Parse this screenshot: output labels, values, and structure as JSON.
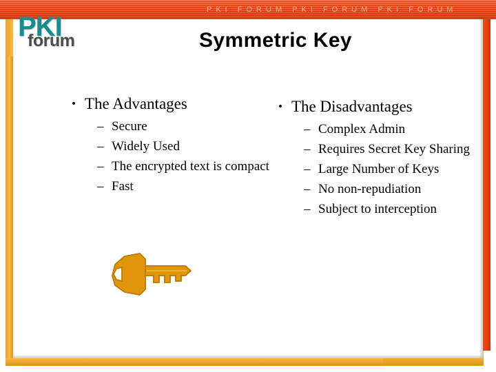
{
  "banner": {
    "repeat_text": "PKI   FORUM   PKI   FORUM   PKI   FORUM",
    "color": "#ef4a17"
  },
  "logo": {
    "line1": "PKI",
    "line2": "forum",
    "pki_color": "#178e8e",
    "forum_color": "#4d4d4d"
  },
  "title": "Symmetric Key",
  "columns": {
    "left": {
      "heading": "The Advantages",
      "bullet_glyph": "•",
      "dash_glyph": "–",
      "items": [
        "Secure",
        "Widely Used",
        "The encrypted text is compact",
        "Fast"
      ]
    },
    "right": {
      "heading": "The Disadvantages",
      "bullet_glyph": "•",
      "dash_glyph": "–",
      "items": [
        "Complex Admin",
        "Requires Secret Key Sharing",
        "Large Number of Keys",
        "No non-repudiation",
        "Subject to interception"
      ]
    }
  },
  "graphics": {
    "key_icon_name": "key-icon",
    "key_color": "#e0950a",
    "key_outline": "#c07f08"
  },
  "frame": {
    "left_bar_color": "#f2aa2d",
    "bottom_bar_color": "#eda52b",
    "right_bar_color": "#e7400f"
  }
}
